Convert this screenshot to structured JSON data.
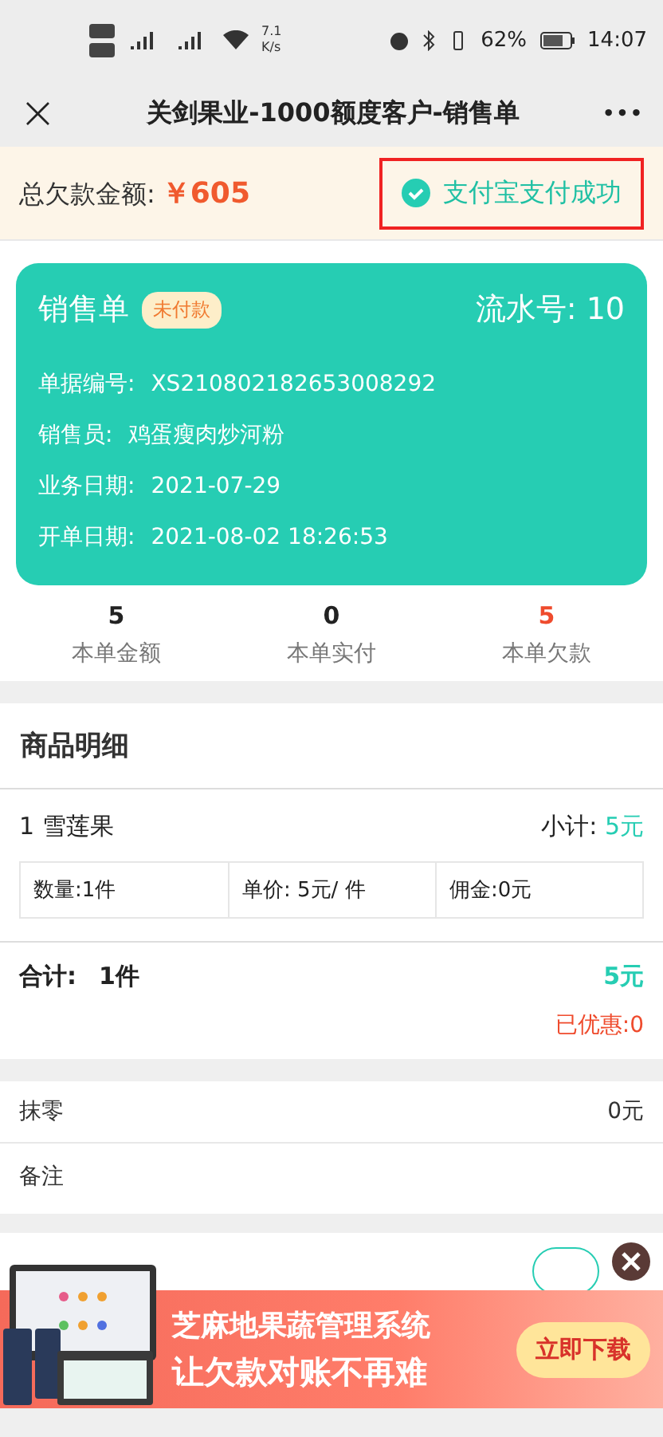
{
  "status_bar": {
    "network_speed": "7.1",
    "speed_unit": "K/s",
    "battery_percent": "62%",
    "time": "14:07"
  },
  "nav": {
    "close": "×",
    "title": "关剑果业-1000额度客户-销售单",
    "more": "•••"
  },
  "debt_bar": {
    "label": "总欠款金额:",
    "amount": "￥605",
    "payment_status": "支付宝支付成功",
    "highlighted": true
  },
  "order_card": {
    "title": "销售单",
    "badge": "未付款",
    "serial": "流水号: 10",
    "fields": [
      {
        "label": "单据编号:",
        "value": "XS210802182653008292"
      },
      {
        "label": "销售员:",
        "value": "鸡蛋瘦肉炒河粉"
      },
      {
        "label": "业务日期:",
        "value": "2021-07-29"
      },
      {
        "label": "开单日期:",
        "value": "2021-08-02 18:26:53"
      }
    ]
  },
  "stats": [
    {
      "value": "5",
      "label": "本单金额",
      "alert": false
    },
    {
      "value": "0",
      "label": "本单实付",
      "alert": false
    },
    {
      "value": "5",
      "label": "本单欠款",
      "alert": true
    }
  ],
  "details": {
    "heading": "商品明细",
    "items": [
      {
        "name": "1  雪莲果",
        "subtotal_label": "小计:",
        "subtotal": "5元",
        "cells": [
          "数量:1件",
          "单价: 5元/ 件",
          "佣金:0元"
        ]
      }
    ],
    "total_label": "合计:",
    "total_qty": "1件",
    "total_amount": "5元",
    "discount": "已优惠:0"
  },
  "extras": [
    {
      "label": "抹零",
      "value": "0元"
    },
    {
      "label": "备注"
    }
  ],
  "ad": {
    "headline": "芝麻地果蔬管理系统",
    "slogan": "让欠款对账不再难",
    "cta": "立即下载"
  }
}
